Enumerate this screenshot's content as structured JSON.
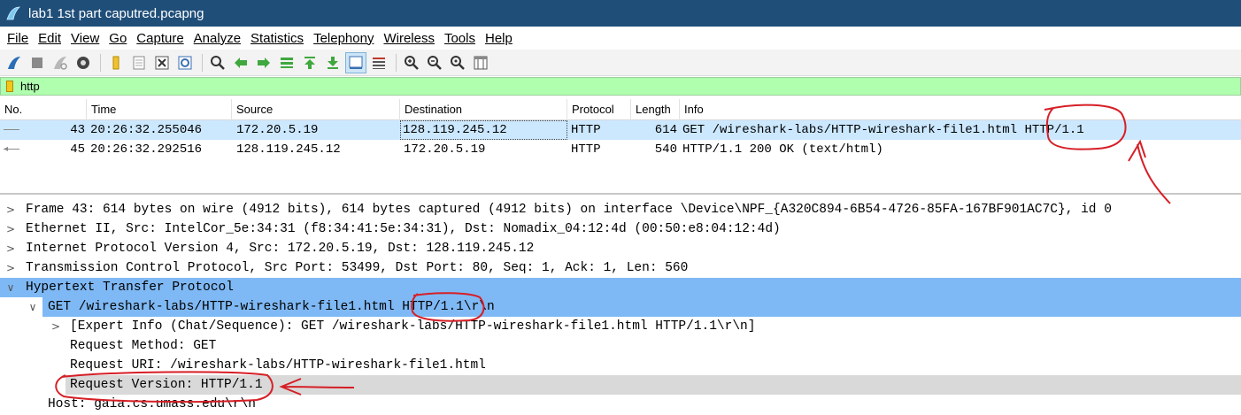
{
  "window": {
    "title": "lab1 1st part caputred.pcapng"
  },
  "menu": [
    {
      "label": "File"
    },
    {
      "label": "Edit"
    },
    {
      "label": "View"
    },
    {
      "label": "Go"
    },
    {
      "label": "Capture"
    },
    {
      "label": "Analyze"
    },
    {
      "label": "Statistics"
    },
    {
      "label": "Telephony"
    },
    {
      "label": "Wireless"
    },
    {
      "label": "Tools"
    },
    {
      "label": "Help"
    }
  ],
  "toolbar": {
    "icons": [
      "shark-fin-start-icon",
      "stop-square-icon",
      "restart-fin-icon",
      "options-gear-icon",
      "open-folder-icon",
      "save-file-icon",
      "close-file-icon",
      "reload-icon",
      "find-magnifier-icon",
      "go-back-arrow-icon",
      "go-forward-arrow-icon",
      "go-to-packet-icon",
      "go-first-icon",
      "go-last-icon",
      "autoscroll-icon",
      "colorize-icon",
      "zoom-in-icon",
      "zoom-out-icon",
      "zoom-normal-icon",
      "resize-columns-icon"
    ]
  },
  "filter": {
    "value": "http"
  },
  "packet_list": {
    "columns": [
      "No.",
      "Time",
      "Source",
      "Destination",
      "Protocol",
      "Length",
      "Info"
    ],
    "rows": [
      {
        "no": "43",
        "time": "20:26:32.255046",
        "source": "172.20.5.19",
        "destination": "128.119.245.12",
        "protocol": "HTTP",
        "length": "614",
        "info": "GET /wireshark-labs/HTTP-wireshark-file1.html HTTP/1.1",
        "selected": true
      },
      {
        "no": "45",
        "time": "20:26:32.292516",
        "source": "128.119.245.12",
        "destination": "172.20.5.19",
        "protocol": "HTTP",
        "length": "540",
        "info": "HTTP/1.1 200 OK  (text/html)",
        "selected": false
      }
    ]
  },
  "details": [
    {
      "text": "Frame 43: 614 bytes on wire (4912 bits), 614 bytes captured (4912 bits) on interface \\Device\\NPF_{A320C894-6B54-4726-85FA-167BF901AC7C}, id 0",
      "expander": "collapsed"
    },
    {
      "text": "Ethernet II, Src: IntelCor_5e:34:31 (f8:34:41:5e:34:31), Dst: Nomadix_04:12:4d (00:50:e8:04:12:4d)",
      "expander": "collapsed"
    },
    {
      "text": "Internet Protocol Version 4, Src: 172.20.5.19, Dst: 128.119.245.12",
      "expander": "collapsed"
    },
    {
      "text": "Transmission Control Protocol, Src Port: 53499, Dst Port: 80, Seq: 1, Ack: 1, Len: 560",
      "expander": "collapsed"
    },
    {
      "text": "Hypertext Transfer Protocol",
      "expander": "expanded"
    },
    {
      "text": "GET /wireshark-labs/HTTP-wireshark-file1.html HTTP/1.1\\r\\n",
      "expander": "expanded"
    },
    {
      "text": "[Expert Info (Chat/Sequence): GET /wireshark-labs/HTTP-wireshark-file1.html HTTP/1.1\\r\\n]",
      "expander": "collapsed"
    },
    {
      "text": "Request Method: GET",
      "expander": "none"
    },
    {
      "text": "Request URI: /wireshark-labs/HTTP-wireshark-file1.html",
      "expander": "none"
    },
    {
      "text": "Request Version: HTTP/1.1",
      "expander": "none"
    },
    {
      "text": "Host: gaia.cs.umass.edu\\r\\n",
      "expander": "none"
    }
  ],
  "colors": {
    "titlebar": "#1f4e79",
    "filter_ok": "#afffaf",
    "row_selected": "#cce8ff",
    "tree_selected": "#7fb9f5",
    "annotation": "#d61f26"
  }
}
